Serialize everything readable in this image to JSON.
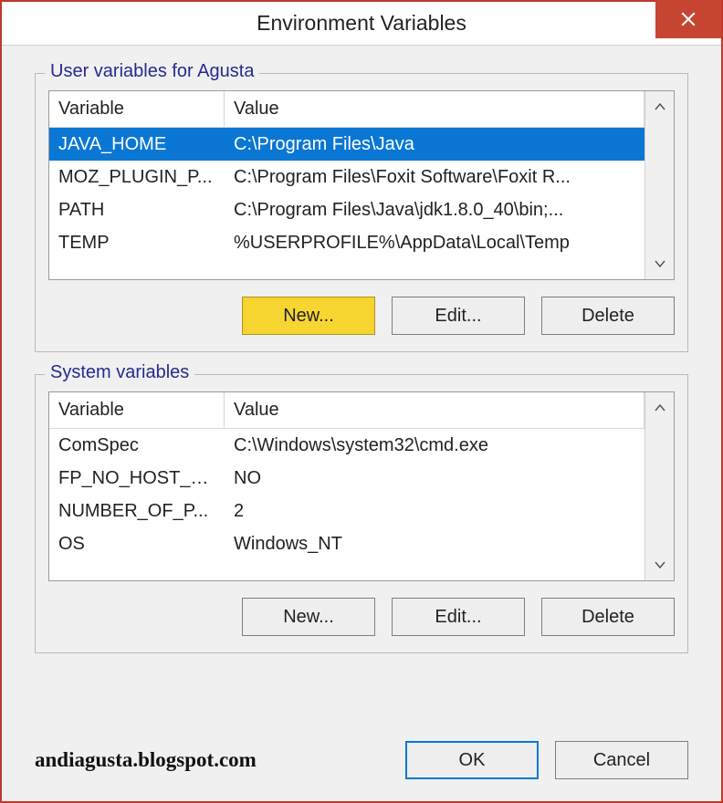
{
  "window": {
    "title": "Environment Variables",
    "close_icon": "×"
  },
  "user_group": {
    "label": "User variables for Agusta",
    "headers": {
      "variable": "Variable",
      "value": "Value"
    },
    "rows": [
      {
        "name": "JAVA_HOME",
        "value": "C:\\Program Files\\Java",
        "selected": true
      },
      {
        "name": "MOZ_PLUGIN_P...",
        "value": "C:\\Program Files\\Foxit Software\\Foxit R...",
        "selected": false
      },
      {
        "name": "PATH",
        "value": "C:\\Program Files\\Java\\jdk1.8.0_40\\bin;...",
        "selected": false
      },
      {
        "name": "TEMP",
        "value": "%USERPROFILE%\\AppData\\Local\\Temp",
        "selected": false
      }
    ],
    "buttons": {
      "new": "New...",
      "edit": "Edit...",
      "delete": "Delete"
    }
  },
  "system_group": {
    "label": "System variables",
    "headers": {
      "variable": "Variable",
      "value": "Value"
    },
    "rows": [
      {
        "name": "ComSpec",
        "value": "C:\\Windows\\system32\\cmd.exe"
      },
      {
        "name": "FP_NO_HOST_C...",
        "value": "NO"
      },
      {
        "name": "NUMBER_OF_P...",
        "value": "2"
      },
      {
        "name": "OS",
        "value": "Windows_NT"
      }
    ],
    "buttons": {
      "new": "New...",
      "edit": "Edit...",
      "delete": "Delete"
    }
  },
  "dialog_buttons": {
    "ok": "OK",
    "cancel": "Cancel"
  },
  "watermark": "andiagusta.blogspot.com"
}
